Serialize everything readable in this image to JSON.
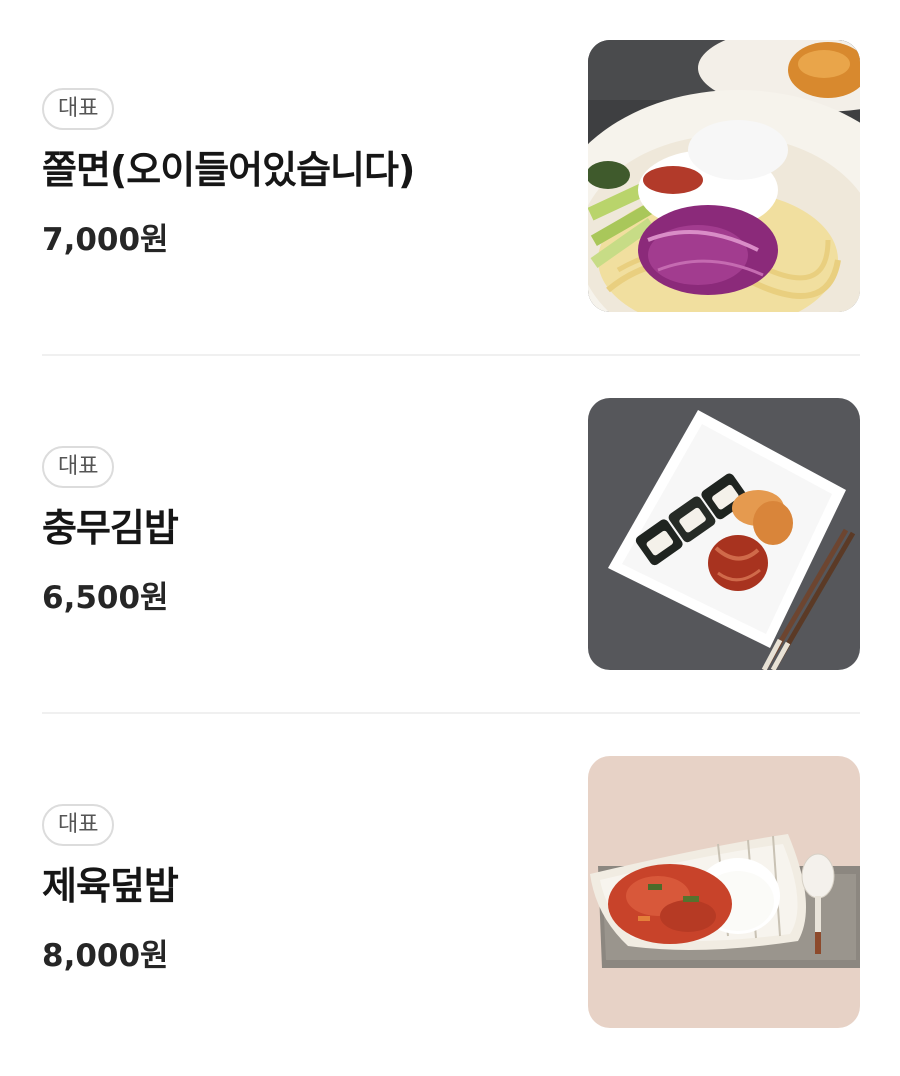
{
  "menu": {
    "items": [
      {
        "badge": "대표",
        "name": "쫄면(오이들어있습니다)",
        "price": "7,000원",
        "image": "jjolmyeon-photo"
      },
      {
        "badge": "대표",
        "name": "충무김밥",
        "price": "6,500원",
        "image": "chungmu-gimbap-photo"
      },
      {
        "badge": "대표",
        "name": "제육덮밥",
        "price": "8,000원",
        "image": "jeyuk-deopbap-photo"
      }
    ]
  },
  "colors": {
    "badge_border": "#dcdcdc",
    "divider": "#f0f0f0",
    "text": "#161616"
  }
}
